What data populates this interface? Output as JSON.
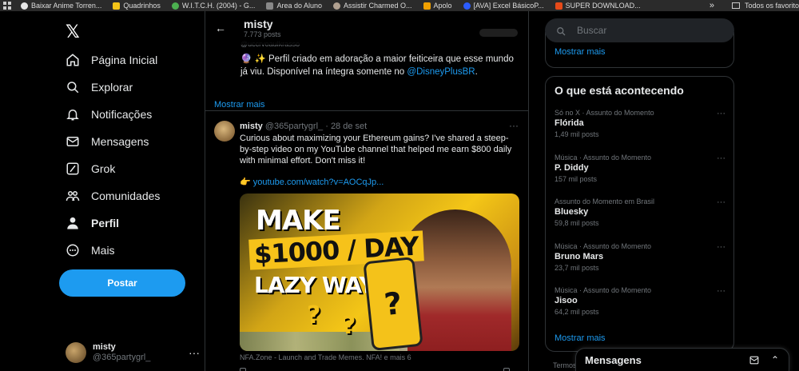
{
  "bookmarks": {
    "items": [
      {
        "label": "Baixar Anime Torren...",
        "color": "#e6e6e6"
      },
      {
        "label": "Quadrinhos",
        "color": "#f5c518"
      },
      {
        "label": "W.I.T.C.H. (2004) - G...",
        "color": "#4caf50"
      },
      {
        "label": "Area do Aluno",
        "color": "#888888"
      },
      {
        "label": "Assistir Charmed O...",
        "color": "#b0a090"
      },
      {
        "label": "Apolo",
        "color": "#f0a000"
      },
      {
        "label": "[AVA] Excel BásicoP...",
        "color": "#2b5cff"
      },
      {
        "label": "SUPER DOWNLOAD...",
        "color": "#e64a19"
      }
    ],
    "overflow": "»",
    "folder": "Todos os favorito"
  },
  "nav": {
    "logo": "𝕏",
    "items": [
      {
        "label": "Página Inicial",
        "icon": "home-icon"
      },
      {
        "label": "Explorar",
        "icon": "search-icon"
      },
      {
        "label": "Notificações",
        "icon": "bell-icon"
      },
      {
        "label": "Mensagens",
        "icon": "envelope-icon"
      },
      {
        "label": "Grok",
        "icon": "grok-icon"
      },
      {
        "label": "Comunidades",
        "icon": "people-icon"
      },
      {
        "label": "Perfil",
        "icon": "person-icon"
      },
      {
        "label": "Mais",
        "icon": "more-circle-icon"
      }
    ],
    "post_button": "Postar",
    "account": {
      "name": "misty",
      "handle": "@365partygrl_",
      "more": "···"
    }
  },
  "header": {
    "back": "←",
    "name": "misty",
    "count": "7.773 posts"
  },
  "profile": {
    "handle": "@uccrvoaulkrasso",
    "bio_emoji": "🔮 ✨",
    "bio_text": "Perfil criado em adoração a maior feiticeira que esse mundo já viu. Disponível na íntegra somente no ",
    "bio_link": "@DisneyPlusBR",
    "bio_end": ".",
    "show_more": "Mostrar mais"
  },
  "tweet": {
    "name": "misty",
    "handle": "@365partygrl_",
    "dot": "·",
    "date": "28 de set",
    "more": "···",
    "text": "Curious about maximizing  your Ethereum gains? I've shared  a steep-by-step video on my YouTube channel that helped me earn $800 daily with minimal effort. Don't miss it!",
    "pointer": "👉",
    "link": "youtube.com/watch?v=AOCqJp...",
    "media": {
      "line1": "MAKE",
      "line2": "$1000 / DAY",
      "line3": "LAZY WAY",
      "q": "?"
    },
    "caption": "NFA.Zone - Launch and Trade Memes. NFA! e mais 6"
  },
  "sidebar": {
    "search_placeholder": "Buscar",
    "prev_more": "Mostrar mais",
    "trends_title": "O que está acontecendo",
    "trends": [
      {
        "meta": "Só no X · Assunto do Momento",
        "title": "Flórida",
        "count": "1,49 mil posts"
      },
      {
        "meta": "Música · Assunto do Momento",
        "title": "P. Diddy",
        "count": "157 mil posts"
      },
      {
        "meta": "Assunto do Momento em Brasil",
        "title": "Bluesky",
        "count": "59,8 mil posts"
      },
      {
        "meta": "Música · Assunto do Momento",
        "title": "Bruno Mars",
        "count": "23,7 mil posts"
      },
      {
        "meta": "Música · Assunto do Momento",
        "title": "Jisoo",
        "count": "64,2 mil posts"
      }
    ],
    "trend_more": "···",
    "trends_more": "Mostrar mais",
    "termos": "Termos"
  },
  "messages_drawer": {
    "title": "Mensagens",
    "collapse": "⌃"
  },
  "colors": {
    "accent": "#1d9bf0",
    "background": "#000000",
    "border": "#2f3336",
    "muted": "#71767b"
  }
}
